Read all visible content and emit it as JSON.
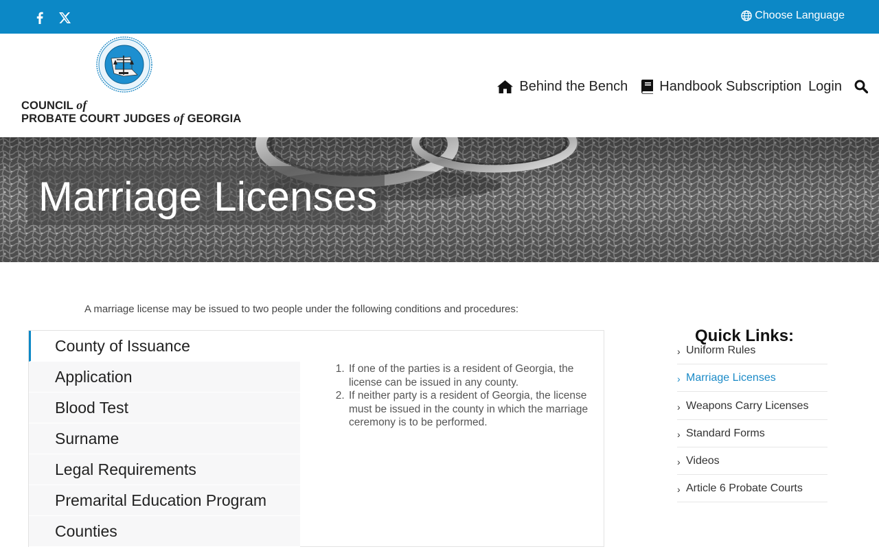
{
  "topbar": {
    "facebook_icon": "facebook-icon",
    "x_icon": "x-twitter-icon",
    "language_label": "Choose Language",
    "accent": "#0c88c6"
  },
  "header": {
    "org_line1_a": "COUNCIL",
    "org_of": "of",
    "org_line2_a": "PROBATE COURT JUDGES",
    "org_line2_b": "GEORGIA",
    "nav": {
      "behind_the_bench": "Behind the Bench",
      "handbook": "Handbook Subscription",
      "login": "Login"
    }
  },
  "hero": {
    "title": "Marriage Licenses"
  },
  "intro": "A marriage license may be issued to two people under the following conditions and procedures:",
  "tabs": [
    {
      "label": "County of Issuance",
      "active": true
    },
    {
      "label": "Application"
    },
    {
      "label": "Blood Test"
    },
    {
      "label": "Surname"
    },
    {
      "label": "Legal Requirements"
    },
    {
      "label": "Premarital Education Program"
    },
    {
      "label": "Counties"
    }
  ],
  "tab_content": [
    "If one of the parties is a resident of Georgia, the license can be issued in any county.",
    "If neither party is a resident of Georgia, the license must be issued in the county in which the marriage ceremony is to be performed."
  ],
  "quick_links": {
    "title": "Quick Links:",
    "items": [
      {
        "label": "Uniform Rules"
      },
      {
        "label": "Marriage Licenses",
        "active": true
      },
      {
        "label": "Weapons Carry Licenses"
      },
      {
        "label": "Standard Forms"
      },
      {
        "label": "Videos"
      },
      {
        "label": "Article 6 Probate Courts"
      }
    ],
    "active_color": "#1a8ac7"
  }
}
